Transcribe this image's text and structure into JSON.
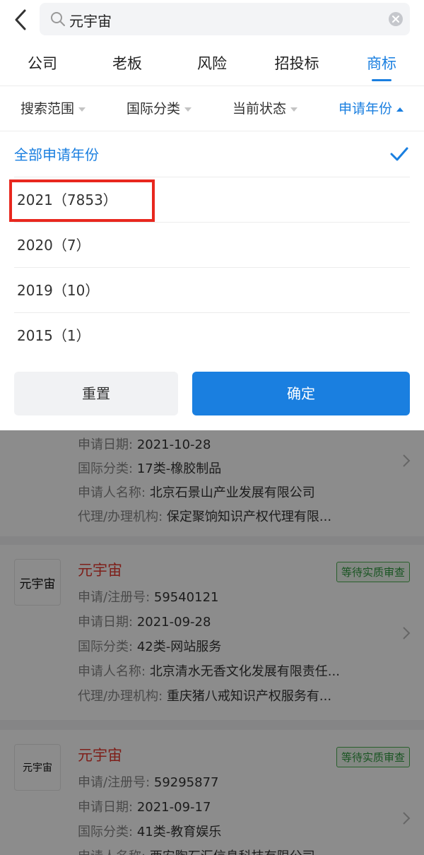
{
  "search": {
    "query": "元宇宙"
  },
  "tabs": [
    {
      "label": "公司"
    },
    {
      "label": "老板"
    },
    {
      "label": "风险"
    },
    {
      "label": "招投标"
    },
    {
      "label": "商标",
      "active": true
    }
  ],
  "filters": [
    {
      "label": "搜索范围"
    },
    {
      "label": "国际分类"
    },
    {
      "label": "当前状态"
    },
    {
      "label": "申请年份",
      "active": true
    }
  ],
  "year_options": [
    {
      "label": "全部申请年份",
      "selected": true
    },
    {
      "label": "2021（7853）"
    },
    {
      "label": "2020（7）"
    },
    {
      "label": "2019（10）"
    },
    {
      "label": "2015（1）"
    }
  ],
  "buttons": {
    "reset": "重置",
    "confirm": "确定"
  },
  "results": {
    "partial_card": {
      "date_label": "申请日期:",
      "date": "2021-10-28",
      "class_label": "国际分类:",
      "class": "17类-橡胶制品",
      "applicant_label": "申请人名称:",
      "applicant": "北京石景山产业发展有限公司",
      "agency_label": "代理/办理机构:",
      "agency": "保定聚饷知识产权代理有限..."
    },
    "cards": [
      {
        "logo_text": "元宇宙",
        "name": "元宇宙",
        "status": "等待实质审查",
        "reg_label": "申请/注册号:",
        "reg": "59540121",
        "date_label": "申请日期:",
        "date": "2021-09-28",
        "class_label": "国际分类:",
        "class": "42类-网站服务",
        "applicant_label": "申请人名称:",
        "applicant": "北京清水无香文化发展有限责任...",
        "agency_label": "代理/办理机构:",
        "agency": "重庆猪八戒知识产权服务有..."
      },
      {
        "logo_text": "元宇宙",
        "name": "元宇宙",
        "status": "等待实质审查",
        "reg_label": "申请/注册号:",
        "reg": "59295877",
        "date_label": "申请日期:",
        "date": "2021-09-17",
        "class_label": "国际分类:",
        "class": "41类-教育娱乐",
        "applicant_label": "申请人名称:",
        "applicant": "西安陶石汇信息科技有限公司"
      }
    ]
  },
  "colors": {
    "accent": "#1a7fe0",
    "highlight": "#e8271e",
    "trademark_name": "#e53a30"
  }
}
